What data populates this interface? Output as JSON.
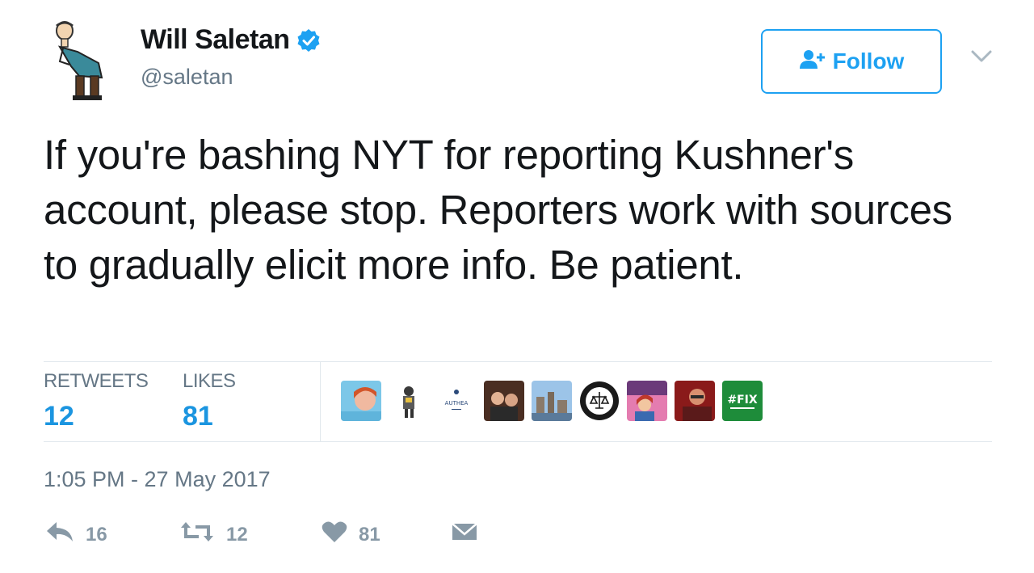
{
  "user": {
    "display_name": "Will Saletan",
    "handle": "@saletan",
    "avatar": "cartoon-avatar",
    "verified": true
  },
  "follow_button": {
    "label": "Follow",
    "icon": "follow-user-icon"
  },
  "menu": {
    "icon": "chevron-down-icon"
  },
  "tweet": {
    "text": "If you're bashing NYT for reporting Kushner's account, please stop. Reporters work with sources to gradually elicit more info. Be patient.",
    "timestamp": "1:05 PM - 27 May 2017"
  },
  "stats": {
    "retweets_label": "RETWEETS",
    "retweets_count": "12",
    "likes_label": "LIKES",
    "likes_count": "81"
  },
  "likers": [
    {
      "name": "liker-avatar-1"
    },
    {
      "name": "liker-avatar-2"
    },
    {
      "name": "liker-avatar-3",
      "text": "AUTHEA"
    },
    {
      "name": "liker-avatar-4"
    },
    {
      "name": "liker-avatar-5"
    },
    {
      "name": "liker-avatar-6"
    },
    {
      "name": "liker-avatar-7"
    },
    {
      "name": "liker-avatar-8"
    },
    {
      "name": "liker-avatar-9",
      "text": "#FIX"
    }
  ],
  "actions": {
    "reply_count": "16",
    "retweet_count": "12",
    "like_count": "81"
  },
  "colors": {
    "accent": "#1da1f2",
    "count_blue": "#1b95e0",
    "secondary_text": "#657786",
    "action_gray": "#8899a6"
  }
}
